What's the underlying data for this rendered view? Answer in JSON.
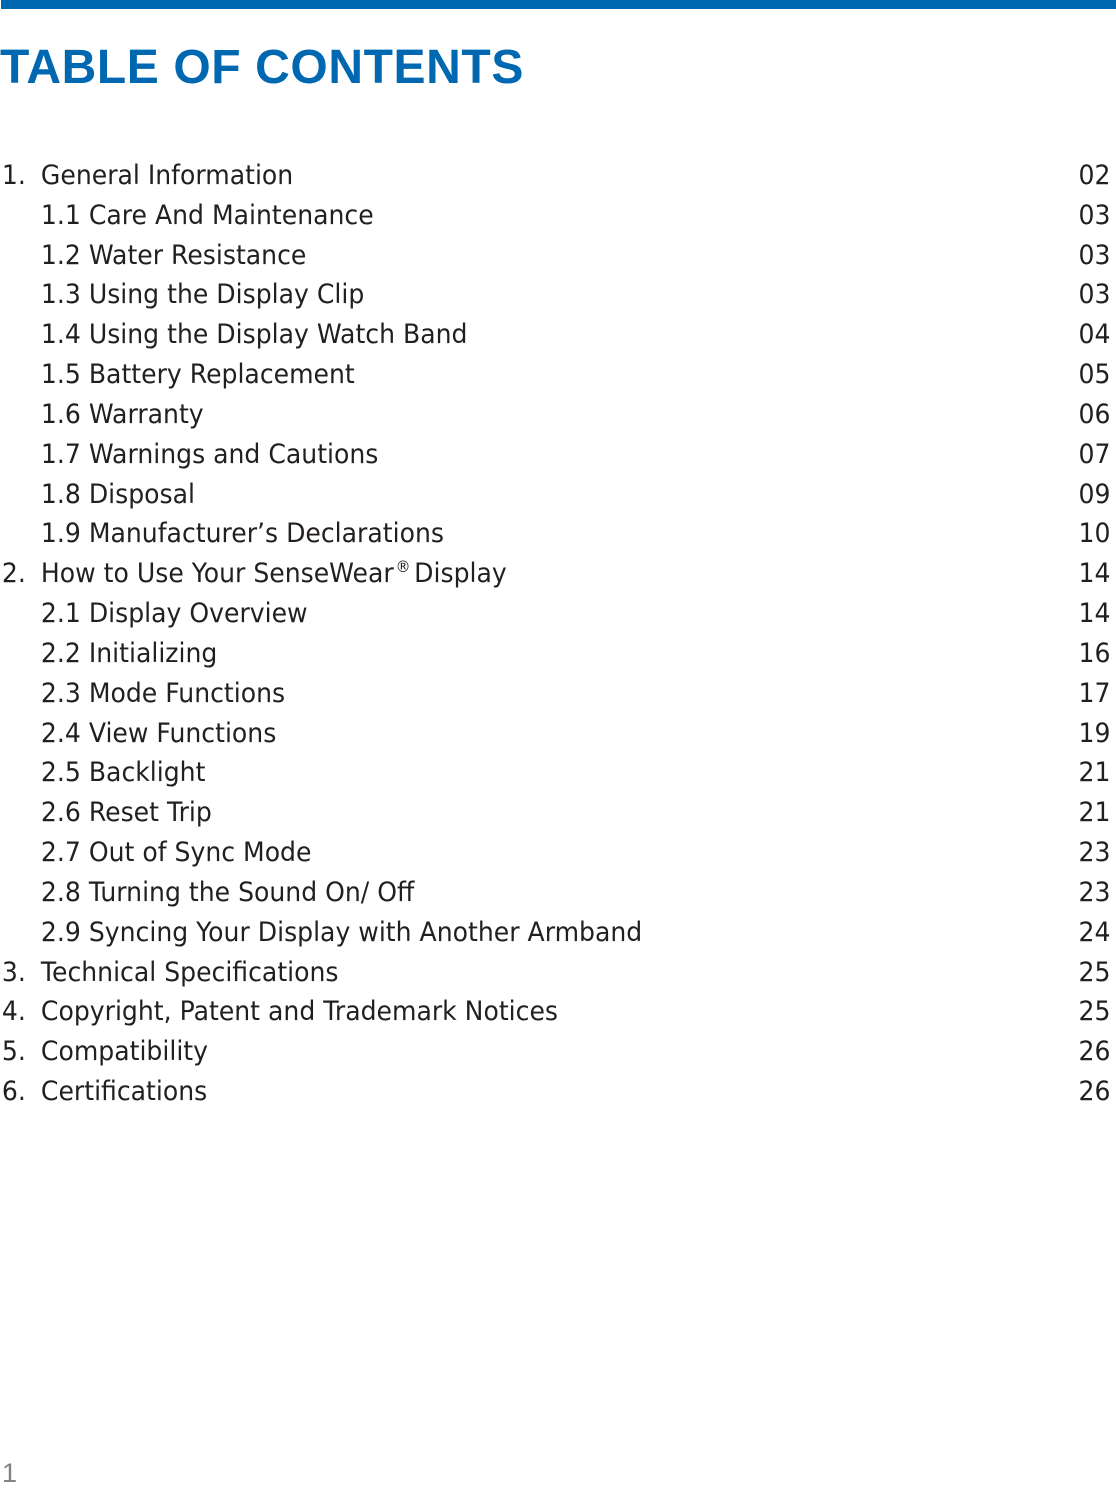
{
  "document": {
    "title": "TABLE OF CONTENTS",
    "page_number": "1",
    "accent_color": "#0067b1",
    "text_color": "#231f20"
  },
  "toc": [
    {
      "level": 1,
      "number": "1.",
      "label": "General Information",
      "page": "02"
    },
    {
      "level": 2,
      "number": "",
      "label": "1.1 Care And Maintenance",
      "page": "03"
    },
    {
      "level": 2,
      "number": "",
      "label": "1.2 Water Resistance",
      "page": "03"
    },
    {
      "level": 2,
      "number": "",
      "label": "1.3 Using the Display Clip",
      "page": "03"
    },
    {
      "level": 2,
      "number": "",
      "label": "1.4 Using the Display Watch Band",
      "page": "04"
    },
    {
      "level": 2,
      "number": "",
      "label": "1.5 Battery Replacement",
      "page": "05"
    },
    {
      "level": 2,
      "number": "",
      "label": "1.6 Warranty",
      "page": "06"
    },
    {
      "level": 2,
      "number": "",
      "label": "1.7 Warnings and Cautions",
      "page": "07"
    },
    {
      "level": 2,
      "number": "",
      "label": "1.8 Disposal",
      "page": "09"
    },
    {
      "level": 2,
      "number": "",
      "label": "1.9 Manufacturer’s Declarations",
      "page": "10"
    },
    {
      "level": 1,
      "number": "2.",
      "label": "How to Use Your SenseWear",
      "label_sup": "®",
      "label_suffix": "Display",
      "page": "14"
    },
    {
      "level": 2,
      "number": "",
      "label": "2.1 Display Overview",
      "page": "14"
    },
    {
      "level": 2,
      "number": "",
      "label": "2.2 Initializing",
      "page": "16"
    },
    {
      "level": 2,
      "number": "",
      "label": "2.3 Mode Functions",
      "page": "17"
    },
    {
      "level": 2,
      "number": "",
      "label": "2.4 View Functions",
      "page": "19"
    },
    {
      "level": 2,
      "number": "",
      "label": "2.5 Backlight",
      "page": "21"
    },
    {
      "level": 2,
      "number": "",
      "label": "2.6 Reset Trip",
      "page": "21"
    },
    {
      "level": 2,
      "number": "",
      "label": "2.7 Out of Sync Mode",
      "page": "23"
    },
    {
      "level": 2,
      "number": "",
      "label": "2.8 Turning the Sound On/ Off",
      "page": "23"
    },
    {
      "level": 2,
      "number": "",
      "label": "2.9 Syncing Your Display with Another Armband",
      "page": "24"
    },
    {
      "level": 1,
      "number": "3.",
      "label": "Technical Specifications",
      "page": "25"
    },
    {
      "level": 1,
      "number": "4.",
      "label": "Copyright, Patent and Trademark Notices",
      "page": "25"
    },
    {
      "level": 1,
      "number": "5.",
      "label": "Compatibility",
      "page": "26"
    },
    {
      "level": 1,
      "number": "6.",
      "label": "Certifications",
      "page": "26"
    }
  ]
}
